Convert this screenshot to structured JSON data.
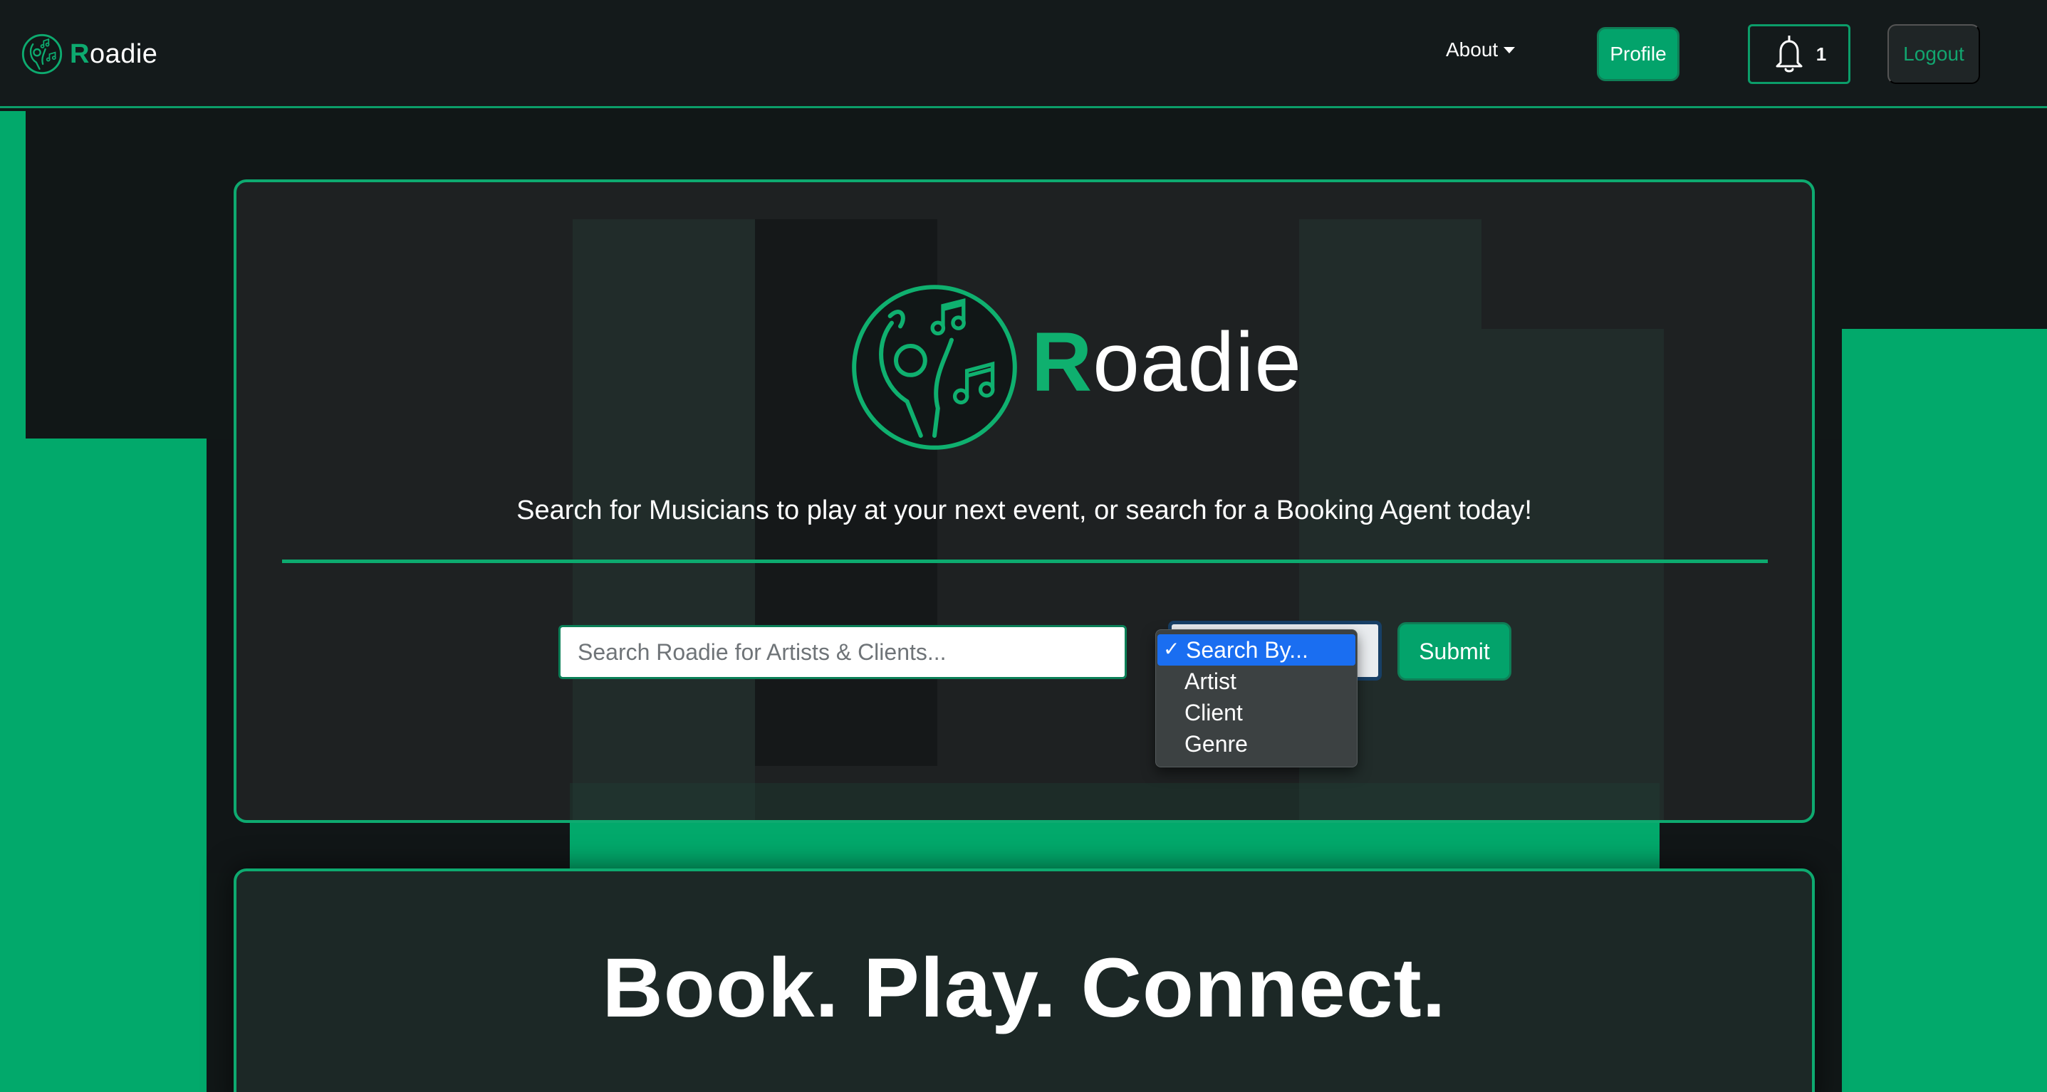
{
  "navbar": {
    "brand_r": "R",
    "brand_rest": "oadie",
    "about_label": "About",
    "profile_label": "Profile",
    "notification_count": "1",
    "logout_label": "Logout"
  },
  "hero": {
    "title_r": "R",
    "title_rest": "oadie",
    "tagline": "Search for Musicians to play at your next event, or search for a Booking Agent today!",
    "search": {
      "placeholder": "Search Roadie for Artists & Clients..."
    },
    "search_by": {
      "selected": "Search By...",
      "options": [
        "Search By...",
        "Artist",
        "Client",
        "Genre"
      ]
    },
    "submit_label": "Submit"
  },
  "section2": {
    "slogan": "Book. Play. Connect."
  },
  "colors": {
    "accent": "#03a36b",
    "background": "#111717",
    "card": "#1f2223",
    "select_highlight": "#1a6ef1"
  }
}
